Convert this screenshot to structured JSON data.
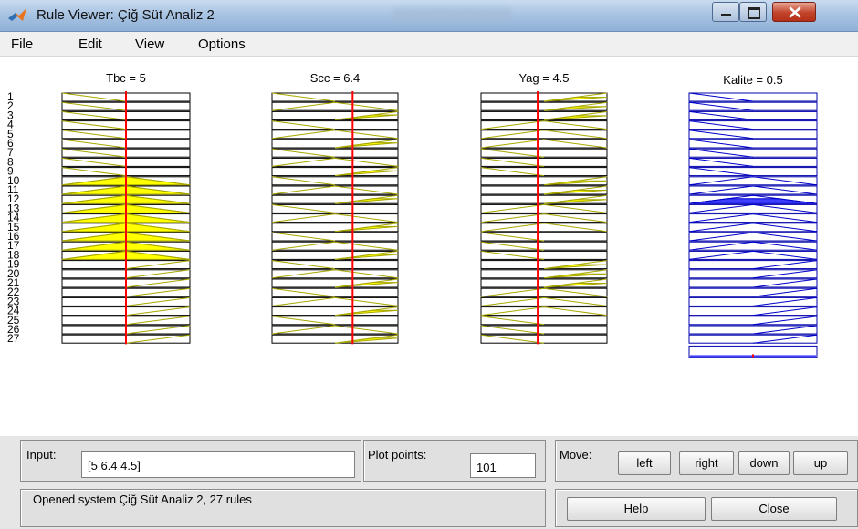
{
  "window": {
    "title": "Rule Viewer: Çiğ Süt Analiz 2"
  },
  "menu": [
    "File",
    "Edit",
    "View",
    "Options"
  ],
  "inputs": [
    {
      "title": "Tbc = 5",
      "value": 5,
      "range": [
        0,
        10
      ]
    },
    {
      "title": "Scc = 6.4",
      "value": 6.4,
      "range": [
        0,
        10
      ]
    },
    {
      "title": "Yag = 4.5",
      "value": 4.5,
      "range": [
        0,
        10
      ]
    }
  ],
  "output": {
    "title": "Kalite = 0.5",
    "value": 0.5,
    "range": [
      0,
      1
    ]
  },
  "rules": {
    "count": 27,
    "numbers": [
      "1",
      "2",
      "3",
      "4",
      "5",
      "6",
      "7",
      "8",
      "9",
      "10",
      "11",
      "12",
      "13",
      "14",
      "15",
      "16",
      "17",
      "18",
      "19",
      "20",
      "21",
      "22",
      "23",
      "24",
      "25",
      "26",
      "27"
    ],
    "tbc_mf": [
      "L",
      "L",
      "L",
      "L",
      "L",
      "L",
      "L",
      "L",
      "L",
      "M",
      "M",
      "M",
      "M",
      "M",
      "M",
      "M",
      "M",
      "M",
      "H",
      "H",
      "H",
      "H",
      "H",
      "H",
      "H",
      "H",
      "H"
    ],
    "tbc_fire": [
      0,
      0,
      0,
      0,
      0,
      0,
      0,
      0,
      0,
      1,
      1,
      1,
      1,
      1,
      1,
      1,
      1,
      1,
      0,
      0,
      0,
      0,
      0,
      0,
      0,
      0,
      0
    ],
    "scc_mf": [
      "L",
      "M",
      "H",
      "L",
      "M",
      "H",
      "L",
      "M",
      "H",
      "L",
      "M",
      "H",
      "L",
      "M",
      "H",
      "L",
      "M",
      "H",
      "L",
      "M",
      "H",
      "L",
      "M",
      "H",
      "L",
      "M",
      "H"
    ],
    "scc_fire": [
      0,
      0,
      0.6,
      0,
      0,
      0.6,
      0,
      0,
      0.6,
      0,
      0,
      0.6,
      0,
      0,
      0.6,
      0,
      0,
      0.6,
      0,
      0,
      0.6,
      0,
      0,
      0.6,
      0,
      0,
      0.6
    ],
    "yag_mf": [
      "H",
      "H",
      "H",
      "M",
      "M",
      "M",
      "L",
      "L",
      "L",
      "H",
      "H",
      "H",
      "M",
      "M",
      "M",
      "L",
      "L",
      "L",
      "H",
      "H",
      "H",
      "M",
      "M",
      "M",
      "L",
      "L",
      "L"
    ],
    "yag_fire": [
      0.5,
      0.5,
      0.5,
      0,
      0,
      0,
      0,
      0,
      0,
      0.5,
      0.5,
      0.5,
      0,
      0,
      0,
      0,
      0,
      0,
      0.5,
      0.5,
      0.5,
      0,
      0,
      0,
      0,
      0,
      0
    ],
    "kalite_mf": [
      "L",
      "L",
      "L",
      "L",
      "L",
      "L",
      "L",
      "L",
      "L",
      "M",
      "M",
      "M",
      "M",
      "M",
      "M",
      "M",
      "M",
      "M",
      "H",
      "H",
      "H",
      "H",
      "H",
      "H",
      "H",
      "H",
      "H"
    ],
    "kalite_fire": [
      0,
      0,
      0,
      0,
      0,
      0,
      0,
      0,
      0,
      0,
      0,
      0.6,
      0,
      0,
      0,
      0,
      0,
      0,
      0,
      0,
      0,
      0,
      0,
      0,
      0,
      0,
      0
    ]
  },
  "colors": {
    "input_fill": "#ffff00",
    "input_line": "#a8a800",
    "output_fill": "#3f3fff",
    "output_line": "#0000cc",
    "indicator": "#ff0000"
  },
  "controls": {
    "input_label": "Input:",
    "input_value": "[5 6.4 4.5]",
    "plot_points_label": "Plot points:",
    "plot_points_value": "101",
    "move_label": "Move:",
    "left": "left",
    "right": "right",
    "down": "down",
    "up": "up",
    "help": "Help",
    "close": "Close",
    "status": "Opened system Çiğ Süt Analiz 2, 27 rules"
  }
}
